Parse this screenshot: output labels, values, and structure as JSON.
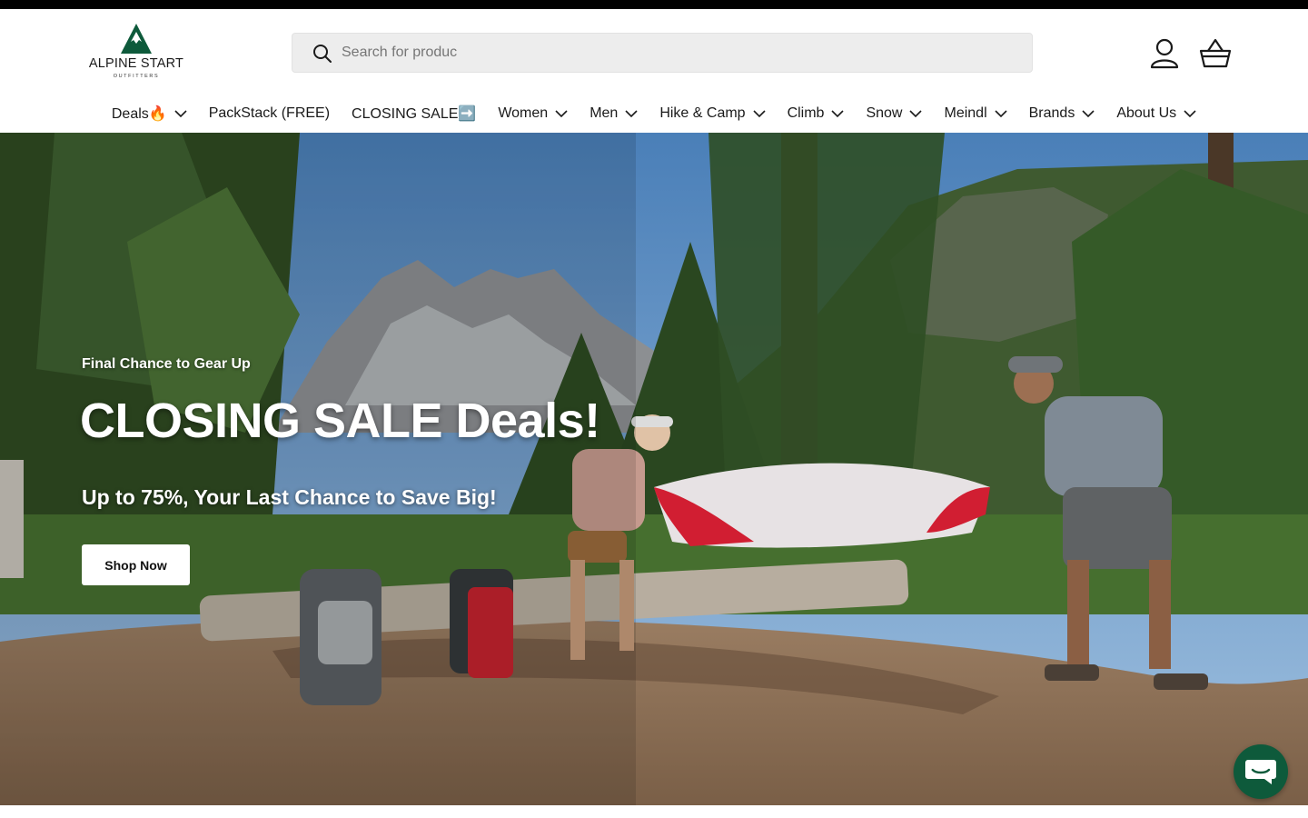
{
  "header": {
    "logo": {
      "brand": "ALPINE START",
      "sub": "OUTFITTERS",
      "mark_color": "#0e5a3b"
    },
    "search": {
      "placeholder": "Search for produc",
      "value": "",
      "icon": "search-icon"
    },
    "account_icon": "user-icon",
    "cart_icon": "basket-icon"
  },
  "nav": {
    "items": [
      {
        "label": "Deals🔥",
        "has_dropdown": true
      },
      {
        "label": "PackStack (FREE)",
        "has_dropdown": false
      },
      {
        "label": "CLOSING SALE➡️",
        "has_dropdown": false
      },
      {
        "label": "Women",
        "has_dropdown": true
      },
      {
        "label": "Men",
        "has_dropdown": true
      },
      {
        "label": "Hike & Camp",
        "has_dropdown": true
      },
      {
        "label": "Climb",
        "has_dropdown": true
      },
      {
        "label": "Snow",
        "has_dropdown": true
      },
      {
        "label": "Meindl",
        "has_dropdown": true
      },
      {
        "label": "Brands",
        "has_dropdown": true
      },
      {
        "label": "About Us",
        "has_dropdown": true
      }
    ]
  },
  "hero": {
    "eyebrow": "Final Chance to Gear Up",
    "title": "CLOSING SALE Deals!",
    "subtitle": "Up to 75%, Your Last Chance to Save Big!",
    "button_label": "Shop Now"
  },
  "chat": {
    "icon": "chat-bubble-icon",
    "color": "#0e5a3b"
  }
}
